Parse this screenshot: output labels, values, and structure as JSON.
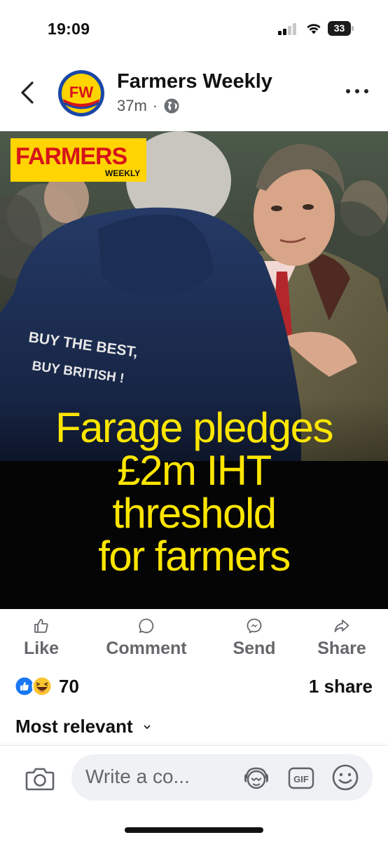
{
  "status_bar": {
    "time": "19:09",
    "battery": "33",
    "signal_bars_active": 2,
    "signal_bars_total": 4
  },
  "post": {
    "page_name": "Farmers Weekly",
    "avatar_text": "FW",
    "time_ago": "37m",
    "separator": "·",
    "audience_icon": "globe-icon"
  },
  "image": {
    "logo_main": "FARMERS",
    "logo_sub": "WEEKLY",
    "hoodie_text_line1": "BUY THE BEST,",
    "hoodie_text_line2": "BUY BRITISH !",
    "headline": [
      "Farage pledges",
      "£2m IHT",
      "threshold",
      "for farmers"
    ]
  },
  "actions": [
    {
      "label": "Like",
      "icon": "thumbs-up-icon"
    },
    {
      "label": "Comment",
      "icon": "comment-bubble-icon"
    },
    {
      "label": "Send",
      "icon": "messenger-icon"
    },
    {
      "label": "Share",
      "icon": "share-arrow-icon"
    }
  ],
  "reactions": {
    "count": "70",
    "shares": "1 share",
    "types": [
      "like-reaction-icon",
      "haha-reaction-icon"
    ]
  },
  "comments": {
    "sort_label": "Most relevant"
  },
  "comment_bar": {
    "placeholder": "Write a co...",
    "gif_label": "GIF"
  },
  "colors": {
    "headline_yellow": "#ffe600",
    "brand_red": "#d7141a",
    "facebook_blue": "#1877f2"
  }
}
